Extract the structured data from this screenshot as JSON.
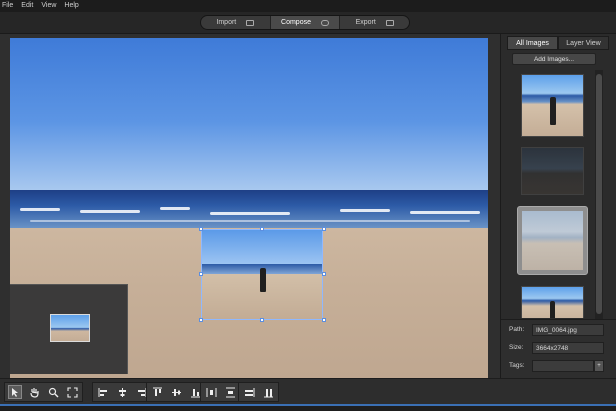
{
  "menu": [
    "File",
    "Edit",
    "View",
    "Help"
  ],
  "modes": [
    {
      "label": "Import",
      "icon": "import-icon",
      "active": false
    },
    {
      "label": "Compose",
      "icon": "compose-icon",
      "active": true
    },
    {
      "label": "Export",
      "icon": "export-icon",
      "active": false
    }
  ],
  "panel": {
    "tabs": [
      {
        "label": "All Images",
        "active": true
      },
      {
        "label": "Layer View",
        "active": false
      }
    ],
    "add_images_label": "Add Images..."
  },
  "properties": {
    "path_label": "Path:",
    "path_value": "IMG_0064.jpg",
    "size_label": "Size:",
    "size_value": "3664x2748",
    "tags_label": "Tags:",
    "tags_value": "",
    "tags_button": "+"
  },
  "toolbar": {
    "tools": [
      {
        "name": "select-tool",
        "icon": "arrow-pointer-icon",
        "active": true
      },
      {
        "name": "pan-tool",
        "icon": "hand-icon",
        "active": false
      },
      {
        "name": "zoom-tool",
        "icon": "magnifier-icon",
        "active": false
      },
      {
        "name": "fit-tool",
        "icon": "fit-expand-icon",
        "active": false
      }
    ],
    "align_tools": [
      "align-left-icon",
      "align-center-icon",
      "align-right-icon"
    ],
    "vertical_tools": [
      "align-top-icon",
      "align-middle-icon",
      "align-bottom-icon"
    ],
    "distribute_tools": [
      "distribute-horizontal-icon",
      "distribute-vertical-icon"
    ],
    "size_tools": [
      "match-width-icon",
      "match-height-icon"
    ]
  },
  "colors": {
    "accent": "#3a6fb4",
    "selection": "#8fb8ff"
  }
}
